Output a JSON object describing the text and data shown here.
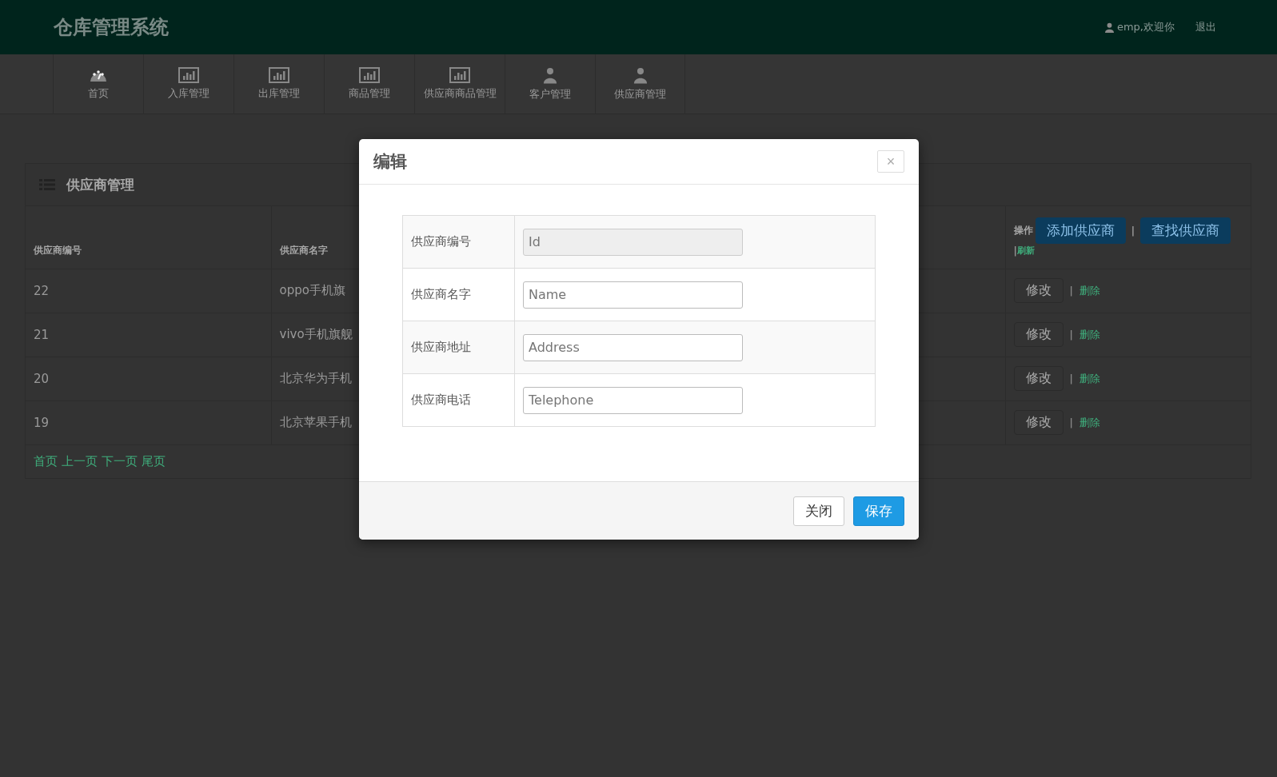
{
  "header": {
    "title": "仓库管理系统",
    "user": "emp,欢迎你",
    "logout": "退出"
  },
  "nav": [
    {
      "label": "首页",
      "kind": "gauge"
    },
    {
      "label": "入库管理",
      "kind": "chart"
    },
    {
      "label": "出库管理",
      "kind": "chart"
    },
    {
      "label": "商品管理",
      "kind": "chart"
    },
    {
      "label": "供应商商品管理",
      "kind": "chart"
    },
    {
      "label": "客户管理",
      "kind": "user"
    },
    {
      "label": "供应商管理",
      "kind": "user"
    }
  ],
  "panel": {
    "title": "供应商管理",
    "columns": [
      "供应商编号",
      "供应商名字"
    ],
    "operations": {
      "label": "操作",
      "add": "添加供应商",
      "separator": "|",
      "find": "查找供应商",
      "refresh_separator": "|",
      "refresh": "刷新"
    },
    "rows": [
      {
        "id": "22",
        "name": "oppo手机旗",
        "edit": "修改",
        "separator": "|",
        "delete": "删除"
      },
      {
        "id": "21",
        "name": "vivo手机旗舰",
        "edit": "修改",
        "separator": "|",
        "delete": "删除"
      },
      {
        "id": "20",
        "name": "北京华为手机",
        "edit": "修改",
        "separator": "|",
        "delete": "删除"
      },
      {
        "id": "19",
        "name": "北京苹果手机",
        "edit": "修改",
        "separator": "|",
        "delete": "删除"
      }
    ],
    "pagination": [
      "首页",
      "上一页",
      "下一页",
      "尾页"
    ]
  },
  "modal": {
    "title": "编辑",
    "close_icon": "×",
    "fields": [
      {
        "label": "供应商编号",
        "placeholder": "Id",
        "disabled": true
      },
      {
        "label": "供应商名字",
        "placeholder": "Name",
        "disabled": false
      },
      {
        "label": "供应商地址",
        "placeholder": "Address",
        "disabled": false
      },
      {
        "label": "供应商电话",
        "placeholder": "Telephone",
        "disabled": false
      }
    ],
    "buttons": [
      {
        "label": "关闭",
        "kind": "default"
      },
      {
        "label": "保存",
        "kind": "primary"
      }
    ]
  }
}
